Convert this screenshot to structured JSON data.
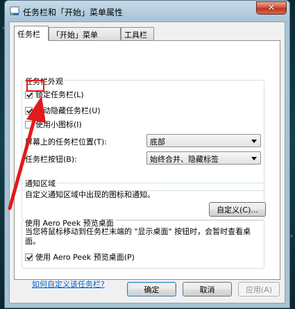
{
  "window": {
    "title": "任务栏和「开始」菜单属性",
    "close_glyph": "✕"
  },
  "tabs": [
    {
      "label": "任务栏"
    },
    {
      "label": "「开始」菜单"
    },
    {
      "label": "工具栏"
    }
  ],
  "appearance": {
    "group_label": "任务栏外观",
    "lock_taskbar": {
      "label": "锁定任务栏(L)",
      "checked": true
    },
    "auto_hide": {
      "label": "自动隐藏任务栏(U)",
      "checked": true
    },
    "small_icons": {
      "label": "使用小图标(I)",
      "checked": false
    },
    "position_label": "屏幕上的任务栏位置(T):",
    "position_value": "底部",
    "buttons_label": "任务栏按钮(B):",
    "buttons_value": "始终合并、隐藏标签"
  },
  "notification": {
    "group_label": "通知区域",
    "description": "自定义通知区域中出现的图标和通知。",
    "customize_button": "自定义(C)..."
  },
  "peek": {
    "group_label": "使用 Aero Peek 预览桌面",
    "description": "当您将鼠标移动到任务栏末端的 \"显示桌面\" 按钮时，会暂时查看桌面。",
    "checkbox": {
      "label": "使用 Aero Peek 预览桌面(P)",
      "checked": true
    }
  },
  "help_link": "如何自定义该任务栏?",
  "footer": {
    "ok": "确定",
    "cancel": "取消",
    "apply": "应用(A)"
  },
  "colors": {
    "annotation": "#e3191c",
    "link": "#0066cc"
  }
}
